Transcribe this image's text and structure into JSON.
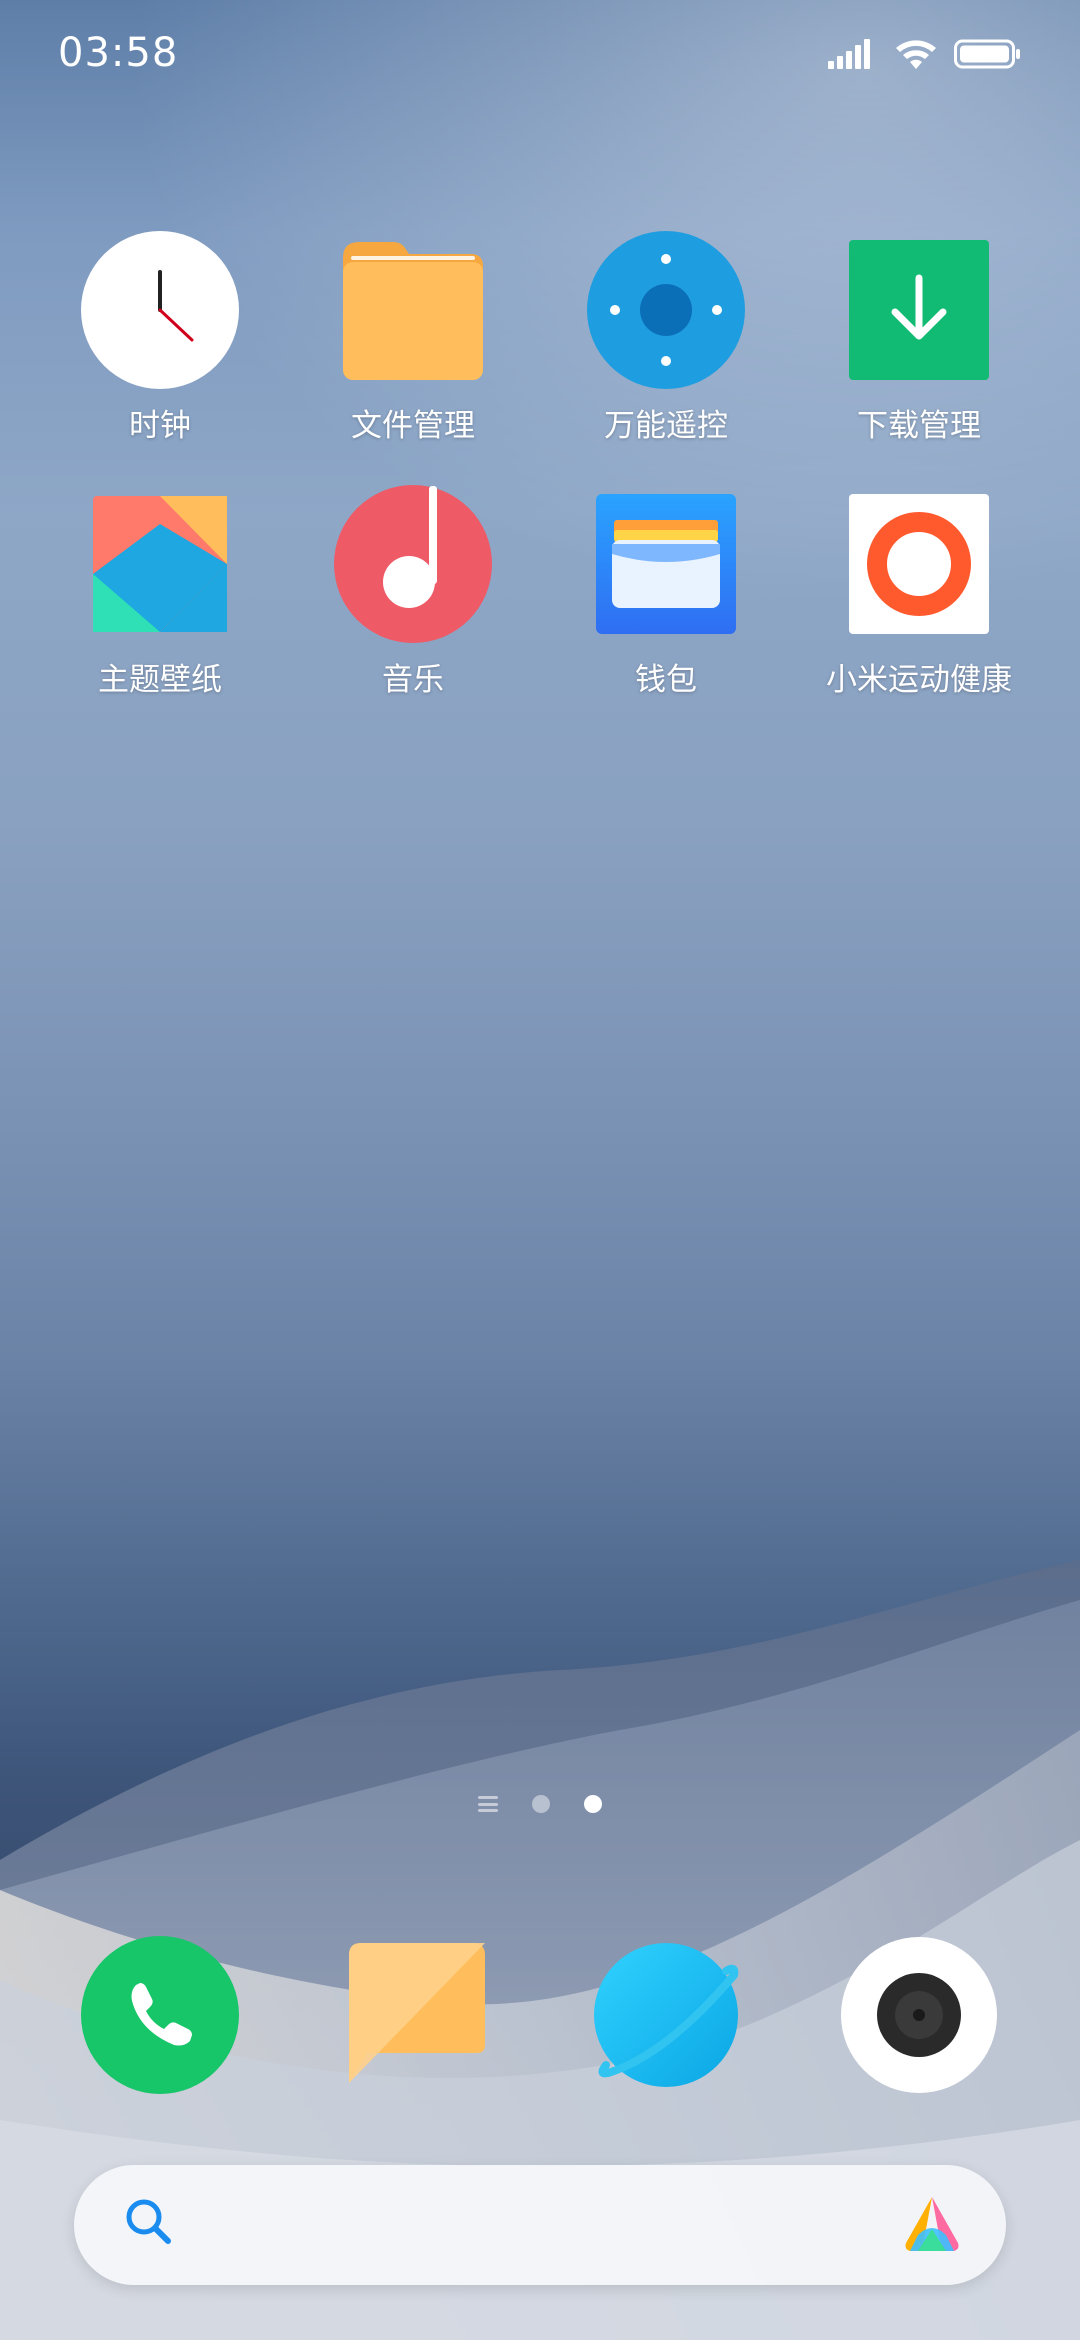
{
  "status_bar": {
    "time": "03:58",
    "icons": [
      "signal-icon",
      "wifi-icon",
      "battery-icon"
    ]
  },
  "apps": [
    {
      "label": "时钟",
      "icon": "clock-icon"
    },
    {
      "label": "文件管理",
      "icon": "folder-icon"
    },
    {
      "label": "万能遥控",
      "icon": "remote-control-icon"
    },
    {
      "label": "下载管理",
      "icon": "download-icon"
    },
    {
      "label": "主题壁纸",
      "icon": "themes-icon"
    },
    {
      "label": "音乐",
      "icon": "music-icon"
    },
    {
      "label": "钱包",
      "icon": "wallet-icon"
    },
    {
      "label": "小米运动健康",
      "icon": "fitness-ring-icon"
    }
  ],
  "pager": {
    "pages": 2,
    "active_page": 2
  },
  "dock": [
    {
      "name": "phone",
      "icon": "phone-icon"
    },
    {
      "name": "messages",
      "icon": "message-icon"
    },
    {
      "name": "browser",
      "icon": "browser-planet-icon"
    },
    {
      "name": "camera",
      "icon": "camera-icon"
    }
  ],
  "search": {
    "placeholder": "",
    "icons": [
      "search-icon",
      "assistant-icon"
    ]
  },
  "colors": {
    "clock_hand": "#d0021b",
    "folder": "#ffbe5b",
    "remote": "#1e9de0",
    "download": "#12bb73",
    "music": "#ee5a66",
    "wallet": "#2f8cf6",
    "fitness": "#ff5a2e",
    "phone": "#16c668",
    "message": "#ffbe5b",
    "browser": "#19b8ee"
  }
}
